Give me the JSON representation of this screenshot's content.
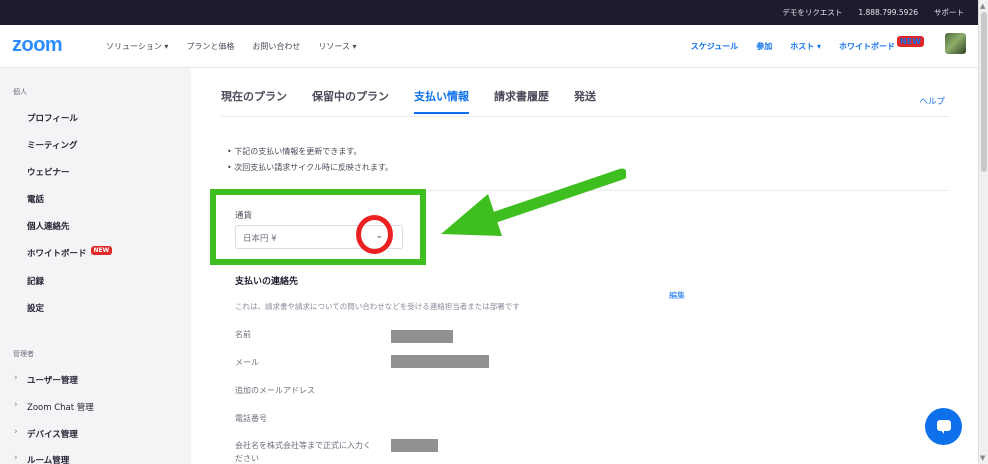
{
  "topbar": {
    "demo": "デモをリクエスト",
    "phone": "1.888.799.5926",
    "support": "サポート"
  },
  "nav": {
    "logo": "zoom",
    "left": [
      "ソリューション ▾",
      "プランと価格",
      "お問い合わせ",
      "リソース ▾"
    ],
    "schedule": "スケジュール",
    "join": "参加",
    "host": "ホスト ▾",
    "whiteboard": "ホワイトボード",
    "new_badge": "NEW"
  },
  "sidebar": {
    "personal_heading": "個人",
    "items": [
      "プロフィール",
      "ミーティング",
      "ウェビナー",
      "電話",
      "個人連絡先",
      "ホワイトボード",
      "記録",
      "設定"
    ],
    "new_badge": "NEW",
    "admin_heading": "管理者",
    "admin_items": [
      "ユーザー管理",
      "Zoom Chat 管理",
      "デバイス管理",
      "ルーム管理"
    ]
  },
  "tabs": [
    "現在のプラン",
    "保留中のプラン",
    "支払い情報",
    "請求書履歴",
    "発送"
  ],
  "active_tab": 2,
  "help": "ヘルプ",
  "notes": [
    "• 下記の支払い情報を更新できます。",
    "• 次回支払い請求サイクル時に反映されます。"
  ],
  "currency": {
    "label": "通貨",
    "value": "日本円 ¥"
  },
  "contact": {
    "title": "支払いの連絡先",
    "description": "これは、請求書や請求についての問い合わせなどを受ける連絡担当者または部署です",
    "edit": "編集",
    "fields": [
      "名前",
      "メール",
      "追加のメールアドレス",
      "電話番号",
      "会社名を株式会社等まで正式に入力ください"
    ]
  },
  "colors": {
    "accent": "#0e71eb",
    "highlight_box": "#3fbf1f",
    "highlight_circle": "#ec2020",
    "redaction": "#919191"
  },
  "icons": {
    "chevron": "chevron-down-icon",
    "chat": "chat-icon"
  }
}
